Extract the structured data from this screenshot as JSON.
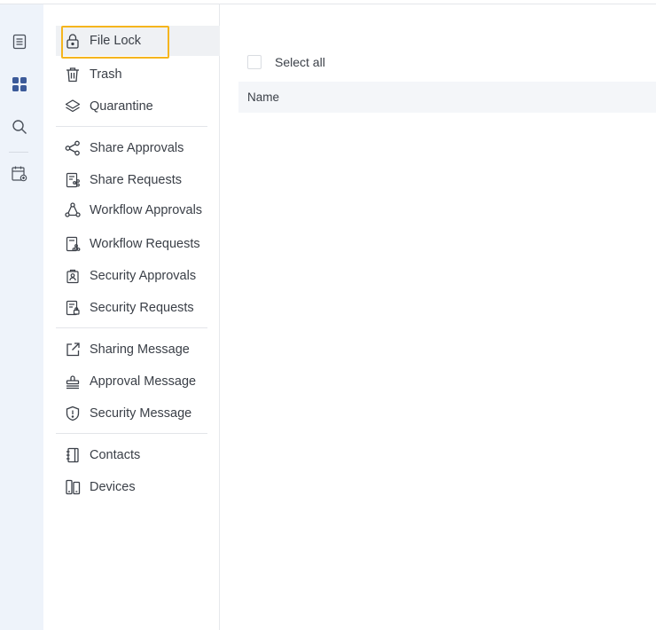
{
  "rail": {
    "items": [
      {
        "icon": "document-list-icon"
      },
      {
        "icon": "apps-grid-icon",
        "color": "#3c5a99"
      },
      {
        "icon": "search-icon"
      },
      {
        "icon": "calendar-share-icon"
      }
    ]
  },
  "menu": {
    "accent": "#f5b51d",
    "groups": [
      [
        {
          "label": "File Lock",
          "icon": "lock-icon",
          "active": true
        },
        {
          "label": "Trash",
          "icon": "trash-icon"
        },
        {
          "label": "Quarantine",
          "icon": "layers-icon"
        }
      ],
      [
        {
          "label": "Share Approvals",
          "icon": "share-icon"
        },
        {
          "label": "Share Requests",
          "icon": "share-request-icon"
        },
        {
          "label": "Workflow Approvals",
          "icon": "workflow-icon"
        },
        {
          "label": "Workflow Requests",
          "icon": "workflow-request-icon"
        },
        {
          "label": "Security Approvals",
          "icon": "security-approval-icon"
        },
        {
          "label": "Security Requests",
          "icon": "security-request-icon"
        }
      ],
      [
        {
          "label": "Sharing Message",
          "icon": "external-share-icon"
        },
        {
          "label": "Approval Message",
          "icon": "stamp-icon"
        },
        {
          "label": "Security Message",
          "icon": "shield-alert-icon"
        }
      ],
      [
        {
          "label": "Contacts",
          "icon": "contacts-icon"
        },
        {
          "label": "Devices",
          "icon": "devices-icon"
        }
      ]
    ]
  },
  "main": {
    "select_all_label": "Select all",
    "columns": [
      "Name"
    ]
  }
}
